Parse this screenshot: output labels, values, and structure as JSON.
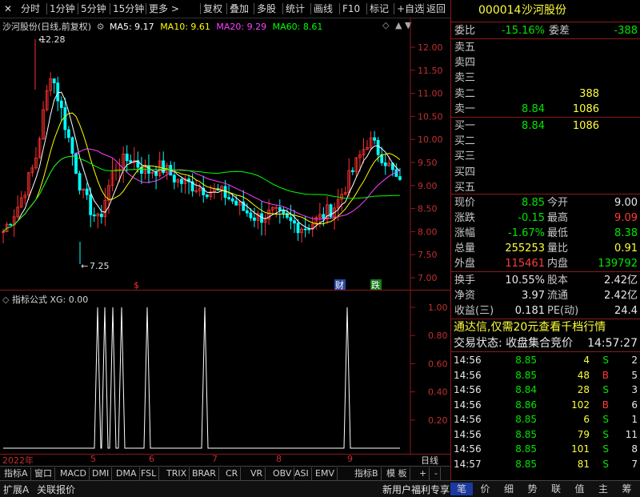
{
  "toolbar": {
    "items": [
      "分时",
      "1分钟",
      "5分钟",
      "15分钟",
      "更多 >",
      "复权",
      "叠加",
      "多股",
      "统计",
      "画线",
      "F10",
      "标记",
      "+自选",
      "返回"
    ],
    "close_icon": "close-x-icon"
  },
  "chart": {
    "title_stock": "沙河股份(日线,前复权)",
    "ma5": "MA5: 9.17",
    "ma10": "MA10: 9.61",
    "ma20": "MA20: 9.29",
    "ma60": "MA60: 8.61",
    "high_label": "12.28",
    "low_label": "7.25",
    "price_ticks": [
      "12.00",
      "11.50",
      "11.00",
      "10.50",
      "10.00",
      "9.50",
      "9.00",
      "8.50",
      "8.00",
      "7.50",
      "7.00"
    ],
    "markers": {
      "s_marker": "$",
      "cai": "财",
      "die": "跌"
    },
    "colors": {
      "ma5": "#ffffff",
      "ma10": "#ffff00",
      "ma20": "#ff40ff",
      "ma60": "#00ff00",
      "up": "#ff3030",
      "down": "#00ffff"
    }
  },
  "indicator": {
    "title": "指标公式 XG: 0.00",
    "ticks": [
      "1.00",
      "0.80",
      "0.60",
      "0.40",
      "0.20"
    ]
  },
  "date_axis": {
    "labels": [
      "2022年",
      "5",
      "6",
      "7",
      "8",
      "9"
    ],
    "period": "日线"
  },
  "tabs": [
    "指标A",
    "窗口",
    "MACD",
    "DMI",
    "DMA",
    "FSL",
    "TRIX",
    "BRAR",
    "CR",
    "VR",
    "OBV",
    "ASI",
    "EMV",
    "指标B",
    "模 板",
    "+",
    "-"
  ],
  "status": {
    "left1": "扩展A",
    "left2": "关联报价",
    "promo": "新用户福利专享",
    "bottom_tabs": [
      "笔",
      "价",
      "细",
      "势",
      "联",
      "值",
      "主",
      "筹"
    ]
  },
  "quote": {
    "code": "000014",
    "name": "沙河股份",
    "weibi_label": "委比",
    "weibi": "-15.16%",
    "weicha_label": "委差",
    "weicha": "-388",
    "sell": [
      {
        "label": "卖五",
        "price": "",
        "vol": ""
      },
      {
        "label": "卖四",
        "price": "",
        "vol": ""
      },
      {
        "label": "卖三",
        "price": "",
        "vol": ""
      },
      {
        "label": "卖二",
        "price": "",
        "vol": "388"
      },
      {
        "label": "卖一",
        "price": "8.84",
        "vol": "1086"
      }
    ],
    "buy": [
      {
        "label": "买一",
        "price": "8.84",
        "vol": "1086"
      },
      {
        "label": "买二",
        "price": "",
        "vol": ""
      },
      {
        "label": "买三",
        "price": "",
        "vol": ""
      },
      {
        "label": "买四",
        "price": "",
        "vol": ""
      },
      {
        "label": "买五",
        "price": "",
        "vol": ""
      }
    ],
    "stats": [
      {
        "l1": "现价",
        "v1": "8.85",
        "c1": "green",
        "l2": "今开",
        "v2": "9.00",
        "c2": "white"
      },
      {
        "l1": "涨跌",
        "v1": "-0.15",
        "c1": "green",
        "l2": "最高",
        "v2": "9.09",
        "c2": "red"
      },
      {
        "l1": "涨幅",
        "v1": "-1.67%",
        "c1": "green",
        "l2": "最低",
        "v2": "8.38",
        "c2": "green"
      },
      {
        "l1": "总量",
        "v1": "255253",
        "c1": "yellow",
        "l2": "量比",
        "v2": "0.91",
        "c2": "yellow"
      },
      {
        "l1": "外盘",
        "v1": "115461",
        "c1": "red",
        "l2": "内盘",
        "v2": "139792",
        "c2": "green"
      }
    ],
    "stats2": [
      {
        "l1": "换手",
        "v1": "10.55%",
        "l2": "股本",
        "v2": "2.42亿"
      },
      {
        "l1": "净资",
        "v1": "3.97",
        "l2": "流通",
        "v2": "2.42亿"
      },
      {
        "l1": "收益(三)",
        "v1": "0.181",
        "l2": "PE(动)",
        "v2": "24.4"
      }
    ],
    "notice": "通达信,仅需20元查看千档行情",
    "trade_status_label": "交易状态: 收盘集合竞价",
    "trade_time": "14:57:27",
    "ticks": [
      {
        "time": "14:56",
        "price": "8.85",
        "vol": "4",
        "bs": "S",
        "n": "2"
      },
      {
        "time": "14:56",
        "price": "8.85",
        "vol": "48",
        "bs": "B",
        "n": "5"
      },
      {
        "time": "14:56",
        "price": "8.84",
        "vol": "28",
        "bs": "S",
        "n": "3"
      },
      {
        "time": "14:56",
        "price": "8.86",
        "vol": "102",
        "bs": "B",
        "n": "6"
      },
      {
        "time": "14:56",
        "price": "8.85",
        "vol": "6",
        "bs": "S",
        "n": "1"
      },
      {
        "time": "14:56",
        "price": "8.85",
        "vol": "79",
        "bs": "S",
        "n": "11"
      },
      {
        "time": "14:56",
        "price": "8.85",
        "vol": "101",
        "bs": "S",
        "n": "8"
      },
      {
        "time": "14:57",
        "price": "8.85",
        "vol": "81",
        "bs": "S",
        "n": "7"
      }
    ]
  }
}
